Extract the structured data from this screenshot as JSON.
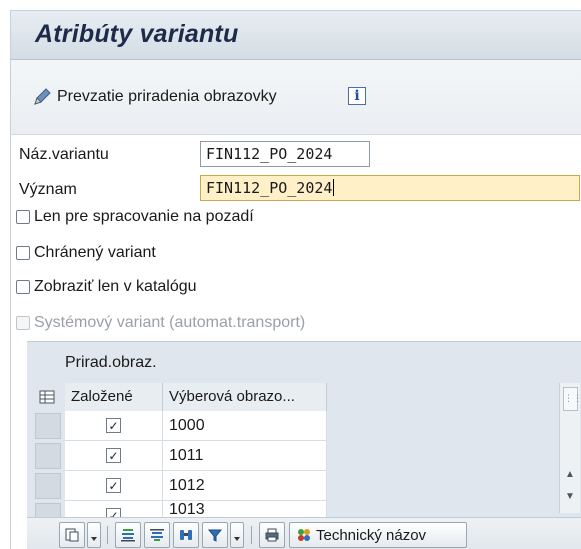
{
  "header": {
    "title": "Atribúty variantu"
  },
  "toolbar": {
    "screen_assignment_label": "Prevzatie priradenia obrazovky",
    "info_label": "i"
  },
  "form": {
    "variant_name_label": "Náz.variantu",
    "variant_name_value": "FIN112_PO_2024",
    "meaning_label": "Význam",
    "meaning_value": "FIN112_PO_2024"
  },
  "checkboxes": [
    {
      "label": "Len pre spracovanie na pozadí",
      "checked": false,
      "disabled": false
    },
    {
      "label": "Chránený variant",
      "checked": false,
      "disabled": false
    },
    {
      "label": "Zobraziť len v katalógu",
      "checked": false,
      "disabled": false
    },
    {
      "label": "Systémový variant (automat.transport)",
      "checked": false,
      "disabled": true
    }
  ],
  "table": {
    "caption": "Prirad.obraz.",
    "columns": [
      "Založené",
      "Výberová obrazo..."
    ],
    "rows": [
      {
        "created": true,
        "screen": "1000"
      },
      {
        "created": true,
        "screen": "1011"
      },
      {
        "created": true,
        "screen": "1012"
      },
      {
        "created": true,
        "screen": "1013"
      }
    ]
  },
  "bottom_toolbar": {
    "technical_name_label": "Technický názov"
  }
}
